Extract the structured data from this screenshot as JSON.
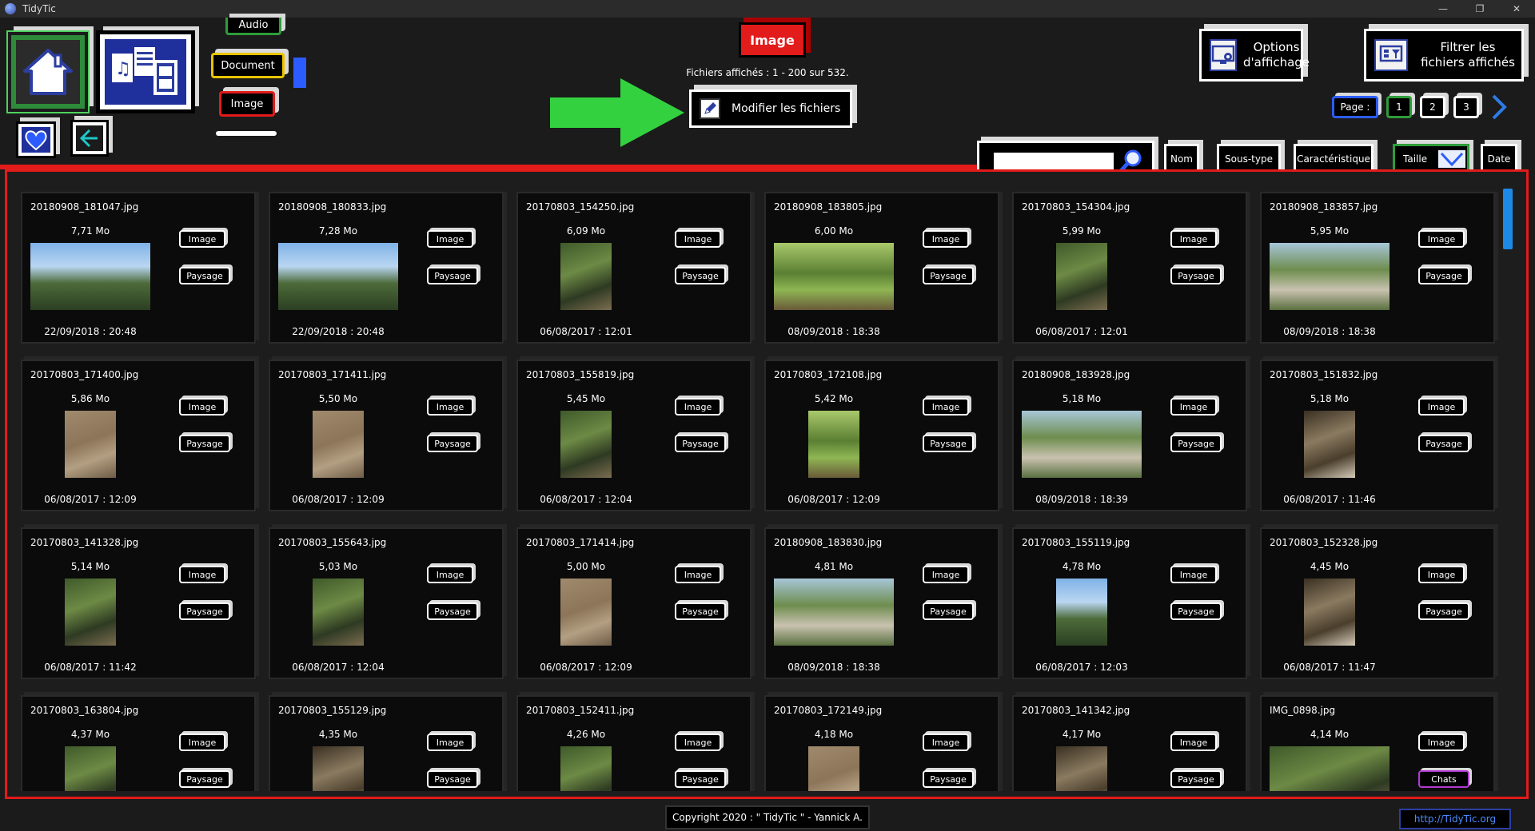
{
  "window": {
    "title": "TidyTic",
    "minimize": "—",
    "maximize": "❐",
    "close": "✕"
  },
  "nav": {
    "types": {
      "audio": "Audio",
      "document": "Document",
      "image": "Image"
    }
  },
  "center": {
    "category_label": "Image",
    "files_info": "Fichiers affichés : 1 - 200 sur 532.",
    "modify_label": "Modifier les fichiers"
  },
  "options": {
    "display_line1": "Options",
    "display_line2": "d'affichage",
    "filter_line1": "Filtrer les",
    "filter_line2": "fichiers affichés"
  },
  "pagination": {
    "label": "Page :",
    "pages": [
      "1",
      "2",
      "3"
    ]
  },
  "search": {
    "value": "",
    "placeholder": ""
  },
  "sort": {
    "nom": "Nom",
    "sous_type": "Sous-type",
    "caracteristique": "Caractéristique",
    "taille": "Taille",
    "date": "Date"
  },
  "cards": [
    {
      "name": "20180908_181047.jpg",
      "size": "7,71 Mo",
      "date": "22/09/2018 : 20:48",
      "type": "Image",
      "subtype": "Paysage",
      "orient": "land",
      "palette": "sky"
    },
    {
      "name": "20180908_180833.jpg",
      "size": "7,28 Mo",
      "date": "22/09/2018 : 20:48",
      "type": "Image",
      "subtype": "Paysage",
      "orient": "land",
      "palette": "sky"
    },
    {
      "name": "20170803_154250.jpg",
      "size": "6,09 Mo",
      "date": "06/08/2017 : 12:01",
      "type": "Image",
      "subtype": "Paysage",
      "orient": "port",
      "palette": "forest"
    },
    {
      "name": "20180908_183805.jpg",
      "size": "6,00 Mo",
      "date": "08/09/2018 : 18:38",
      "type": "Image",
      "subtype": "Paysage",
      "orient": "land",
      "palette": "park"
    },
    {
      "name": "20170803_154304.jpg",
      "size": "5,99 Mo",
      "date": "06/08/2017 : 12:01",
      "type": "Image",
      "subtype": "Paysage",
      "orient": "port",
      "palette": "forest"
    },
    {
      "name": "20180908_183857.jpg",
      "size": "5,95 Mo",
      "date": "08/09/2018 : 18:38",
      "type": "Image",
      "subtype": "Paysage",
      "orient": "land",
      "palette": "garden"
    },
    {
      "name": "20170803_171400.jpg",
      "size": "5,86 Mo",
      "date": "06/08/2017 : 12:09",
      "type": "Image",
      "subtype": "Paysage",
      "orient": "port",
      "palette": "dirt"
    },
    {
      "name": "20170803_171411.jpg",
      "size": "5,50 Mo",
      "date": "06/08/2017 : 12:09",
      "type": "Image",
      "subtype": "Paysage",
      "orient": "port",
      "palette": "dirt"
    },
    {
      "name": "20170803_155819.jpg",
      "size": "5,45 Mo",
      "date": "06/08/2017 : 12:04",
      "type": "Image",
      "subtype": "Paysage",
      "orient": "port",
      "palette": "forest"
    },
    {
      "name": "20170803_172108.jpg",
      "size": "5,42 Mo",
      "date": "06/08/2017 : 12:09",
      "type": "Image",
      "subtype": "Paysage",
      "orient": "port",
      "palette": "park"
    },
    {
      "name": "20180908_183928.jpg",
      "size": "5,18 Mo",
      "date": "08/09/2018 : 18:39",
      "type": "Image",
      "subtype": "Paysage",
      "orient": "land",
      "palette": "garden"
    },
    {
      "name": "20170803_151832.jpg",
      "size": "5,18 Mo",
      "date": "06/08/2017 : 11:46",
      "type": "Image",
      "subtype": "Paysage",
      "orient": "port",
      "palette": "dark"
    },
    {
      "name": "20170803_141328.jpg",
      "size": "5,14 Mo",
      "date": "06/08/2017 : 11:42",
      "type": "Image",
      "subtype": "Paysage",
      "orient": "port",
      "palette": "forest"
    },
    {
      "name": "20170803_155643.jpg",
      "size": "5,03 Mo",
      "date": "06/08/2017 : 12:04",
      "type": "Image",
      "subtype": "Paysage",
      "orient": "port",
      "palette": "forest"
    },
    {
      "name": "20170803_171414.jpg",
      "size": "5,00 Mo",
      "date": "06/08/2017 : 12:09",
      "type": "Image",
      "subtype": "Paysage",
      "orient": "port",
      "palette": "dirt"
    },
    {
      "name": "20180908_183830.jpg",
      "size": "4,81 Mo",
      "date": "08/09/2018 : 18:38",
      "type": "Image",
      "subtype": "Paysage",
      "orient": "land",
      "palette": "garden"
    },
    {
      "name": "20170803_155119.jpg",
      "size": "4,78 Mo",
      "date": "06/08/2017 : 12:03",
      "type": "Image",
      "subtype": "Paysage",
      "orient": "port",
      "palette": "sky"
    },
    {
      "name": "20170803_152328.jpg",
      "size": "4,45 Mo",
      "date": "06/08/2017 : 11:47",
      "type": "Image",
      "subtype": "Paysage",
      "orient": "port",
      "palette": "dark"
    },
    {
      "name": "20170803_163804.jpg",
      "size": "4,37 Mo",
      "date": "",
      "type": "Image",
      "subtype": "Paysage",
      "orient": "port",
      "palette": "forest"
    },
    {
      "name": "20170803_155129.jpg",
      "size": "4,35 Mo",
      "date": "",
      "type": "Image",
      "subtype": "Paysage",
      "orient": "port",
      "palette": "dark"
    },
    {
      "name": "20170803_152411.jpg",
      "size": "4,26 Mo",
      "date": "",
      "type": "Image",
      "subtype": "Paysage",
      "orient": "port",
      "palette": "forest"
    },
    {
      "name": "20170803_172149.jpg",
      "size": "4,18 Mo",
      "date": "",
      "type": "Image",
      "subtype": "Paysage",
      "orient": "port",
      "palette": "dirt"
    },
    {
      "name": "20170803_141342.jpg",
      "size": "4,17 Mo",
      "date": "",
      "type": "Image",
      "subtype": "Paysage",
      "orient": "port",
      "palette": "dark"
    },
    {
      "name": "IMG_0898.jpg",
      "size": "4,14 Mo",
      "date": "",
      "type": "Image",
      "subtype": "Chats",
      "orient": "land",
      "palette": "forest"
    }
  ],
  "footer": {
    "copyright": "Copyright 2020 : \" TidyTic \" - Yannick A.",
    "link": "http://TidyTic.org"
  },
  "colors": {
    "accent_red": "#e21b1b",
    "accent_green": "#2e9d3a",
    "accent_blue": "#2c5cff",
    "accent_yellow": "#e8c400"
  }
}
